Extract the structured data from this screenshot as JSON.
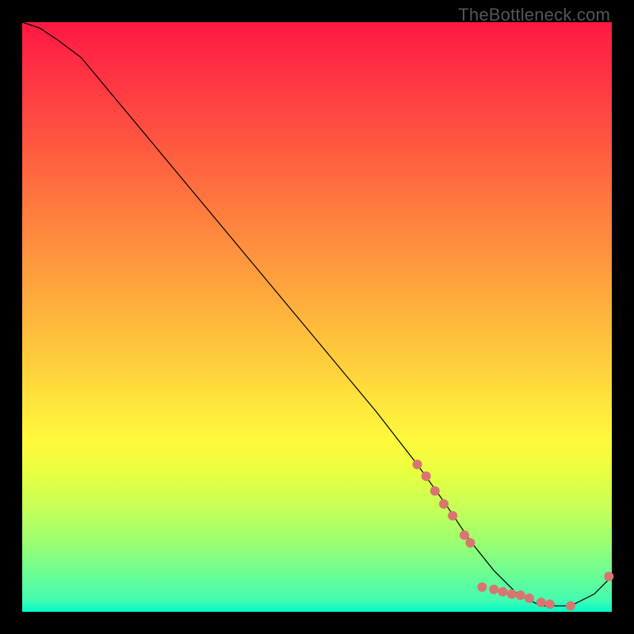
{
  "watermark": "TheBottleneck.com",
  "chart_data": {
    "type": "line",
    "title": "",
    "xlabel": "",
    "ylabel": "",
    "xlim": [
      0,
      100
    ],
    "ylim": [
      0,
      100
    ],
    "grid": false,
    "legend": false,
    "series": [
      {
        "name": "curve",
        "x": [
          0,
          3,
          6,
          10,
          20,
          30,
          40,
          50,
          60,
          67,
          72,
          76,
          80,
          84,
          88,
          93,
          97,
          100
        ],
        "y": [
          100,
          99,
          97,
          94,
          82,
          70,
          58,
          46,
          34,
          25,
          18,
          12,
          7,
          3,
          1,
          1,
          3,
          6
        ],
        "stroke": "#000000",
        "stroke_width": 1.2
      }
    ],
    "markers": [
      {
        "x": 67.0,
        "y": 25.0
      },
      {
        "x": 68.5,
        "y": 23.0
      },
      {
        "x": 70.0,
        "y": 20.5
      },
      {
        "x": 71.5,
        "y": 18.3
      },
      {
        "x": 73.0,
        "y": 16.3
      },
      {
        "x": 75.0,
        "y": 13.0
      },
      {
        "x": 76.0,
        "y": 11.7
      },
      {
        "x": 78.0,
        "y": 4.2
      },
      {
        "x": 80.0,
        "y": 3.8
      },
      {
        "x": 81.5,
        "y": 3.4
      },
      {
        "x": 83.0,
        "y": 3.0
      },
      {
        "x": 84.5,
        "y": 2.8
      },
      {
        "x": 86.0,
        "y": 2.3
      },
      {
        "x": 88.0,
        "y": 1.6
      },
      {
        "x": 89.5,
        "y": 1.3
      },
      {
        "x": 93.0,
        "y": 1.0
      },
      {
        "x": 99.5,
        "y": 6.0
      }
    ],
    "marker_style": {
      "fill": "#d97570",
      "radius": 6
    }
  }
}
